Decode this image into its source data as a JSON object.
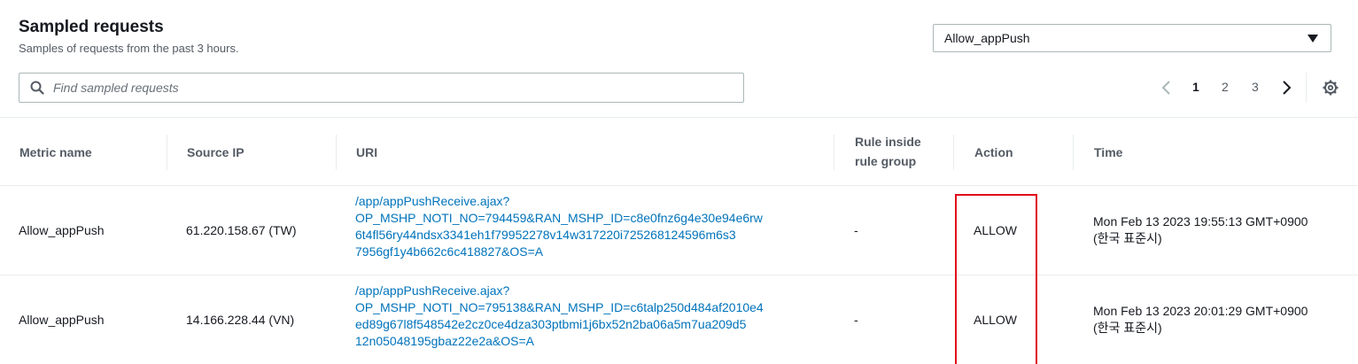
{
  "header": {
    "title": "Sampled requests",
    "subtitle": "Samples of requests from the past 3 hours."
  },
  "rule_select": {
    "value": "Allow_appPush"
  },
  "search": {
    "placeholder": "Find sampled requests",
    "value": ""
  },
  "pagination": {
    "pages": [
      "1",
      "2",
      "3"
    ],
    "current": "1"
  },
  "table": {
    "columns": [
      "Metric name",
      "Source IP",
      "URI",
      "Rule inside rule group",
      "Action",
      "Time"
    ],
    "rows": [
      {
        "metric_name": "Allow_appPush",
        "source_ip": "61.220.158.67 (TW)",
        "uri_lines": [
          "/app/appPushReceive.ajax?",
          "OP_MSHP_NOTI_NO=794459&RAN_MSHP_ID=c8e0fnz6g4e30e94e6rw",
          "6t4fl56ry44ndsx3341eh1f79952278v14w317220i725268124596m6s3",
          "7956gf1y4b662c6c418827&OS=A"
        ],
        "rule_in_group": "-",
        "action": "ALLOW",
        "time_line1": "Mon Feb 13 2023 19:55:13 GMT+0900",
        "time_line2": "(한국 표준시)"
      },
      {
        "metric_name": "Allow_appPush",
        "source_ip": "14.166.228.44 (VN)",
        "uri_lines": [
          "/app/appPushReceive.ajax?",
          "OP_MSHP_NOTI_NO=795138&RAN_MSHP_ID=c6talp250d484af2010e4",
          "ed89g67l8f548542e2cz0ce4dza303ptbmi1j6bx52n2ba06a5m7ua209d5",
          "12n05048195gbaz22e2a&OS=A"
        ],
        "rule_in_group": "-",
        "action": "ALLOW",
        "time_line1": "Mon Feb 13 2023 20:01:29 GMT+0900",
        "time_line2": "(한국 표준시)"
      }
    ]
  },
  "colors": {
    "link": "#0073bb",
    "highlight": "#e0021a"
  }
}
